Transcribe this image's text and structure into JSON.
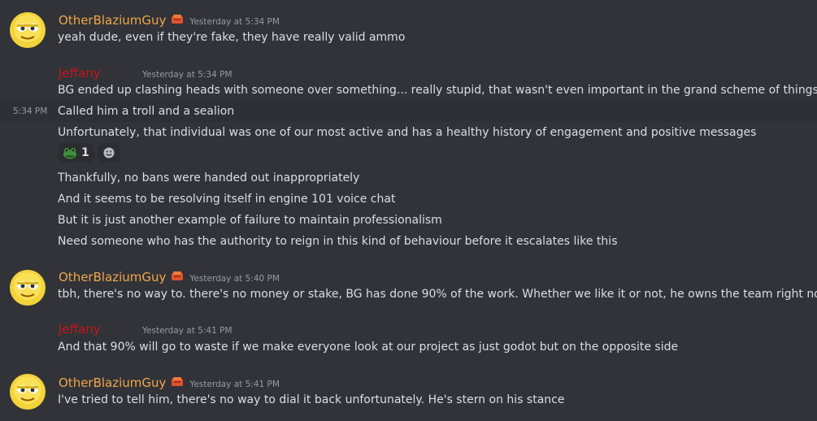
{
  "messages": [
    {
      "user": "OtherBlaziumGuy",
      "timestamp": "Yesterday at 5:34 PM",
      "lines": [
        "yeah dude, even if they're fake, they have really valid ammo"
      ]
    },
    {
      "user": "Jeffany",
      "timestamp": "Yesterday at 5:34 PM",
      "lines": [
        "BG ended up clashing heads with someone over something... really stupid, that wasn't even important in the grand scheme of things",
        "Called him a troll and a sealion",
        "Unfortunately, that individual was one of our most active and has a healthy history of engagement and positive messages",
        "Thankfully, no bans were handed out inappropriately",
        "And it seems to be resolving itself in engine 101 voice chat",
        "But it is just another example of failure to maintain professionalism",
        "Need someone who has the authority to reign in this kind of behaviour before it escalates like this"
      ],
      "hover_timestamp": "5:34 PM",
      "reaction": {
        "icon": "frog-emoji-icon",
        "count": "1"
      }
    },
    {
      "user": "OtherBlaziumGuy",
      "timestamp": "Yesterday at 5:40 PM",
      "lines": [
        "tbh, there's no way to. there's no money or stake, BG has done 90% of the work. Whether we like it or not, he owns the team right now"
      ]
    },
    {
      "user": "Jeffany",
      "timestamp": "Yesterday at 5:41 PM",
      "lines": [
        "And that 90% will go to waste if we make everyone look at our project as just godot but on the opposite side"
      ]
    },
    {
      "user": "OtherBlaziumGuy",
      "timestamp": "Yesterday at 5:41 PM",
      "lines": [
        "I've tried to tell him, there's no way to dial it back unfortunately. He's stern on his stance"
      ]
    }
  ],
  "colors": {
    "background": "#313338",
    "blazium_name": "#f0a64a",
    "jeffany_name": "#c4161c",
    "text": "#dbdee1",
    "muted": "#949ba4"
  }
}
